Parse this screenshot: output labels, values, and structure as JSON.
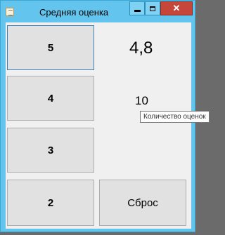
{
  "window": {
    "title": "Средняя оценка"
  },
  "grades": [
    "5",
    "4",
    "3",
    "2"
  ],
  "average": "4,8",
  "count": "10",
  "tooltip": "Количество оценок",
  "reset_label": "Сброс",
  "colors": {
    "title_bar": "#63c5ee",
    "close_button": "#c7463a",
    "button_face": "#e1e1e1"
  }
}
